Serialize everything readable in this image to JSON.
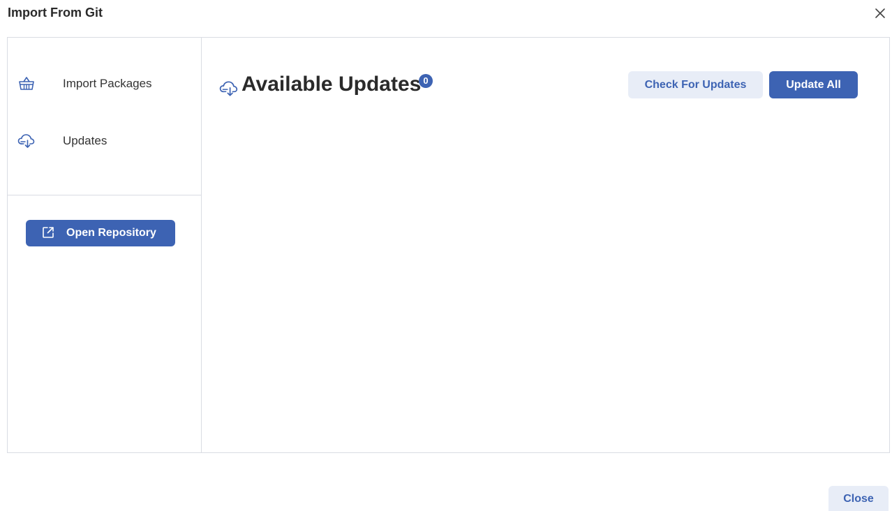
{
  "dialog": {
    "title": "Import From Git",
    "close_icon": "close-icon"
  },
  "sidebar": {
    "items": [
      {
        "label": "Import Packages",
        "icon": "basket-icon"
      },
      {
        "label": "Updates",
        "icon": "cloud-download-icon"
      }
    ],
    "open_repository": {
      "label": "Open Repository",
      "icon": "external-link-icon"
    }
  },
  "main": {
    "title": "Available Updates",
    "title_icon": "cloud-download-icon",
    "count": "0",
    "check_updates_label": "Check For Updates",
    "update_all_label": "Update All"
  },
  "footer": {
    "close_label": "Close"
  },
  "colors": {
    "accent": "#3d63b3",
    "accent_light": "#e8edf7",
    "border": "#d9dce3"
  }
}
